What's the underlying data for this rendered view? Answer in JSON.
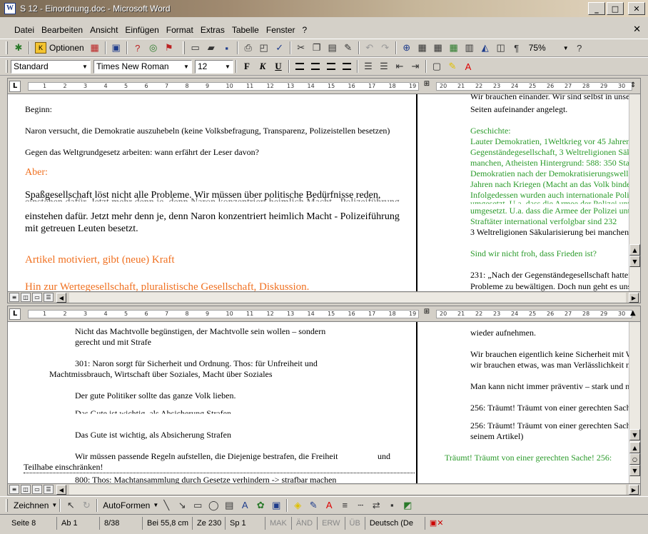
{
  "window": {
    "title": "S 12 - Einordnung.doc - Microsoft Word",
    "app_icon": "W"
  },
  "menu": [
    "Datei",
    "Bearbeiten",
    "Ansicht",
    "Einfügen",
    "Format",
    "Extras",
    "Tabelle",
    "Fenster",
    "?"
  ],
  "toolbar": {
    "options_label": "Optionen",
    "zoom": "75%"
  },
  "format_bar": {
    "style": "Standard",
    "font": "Times New Roman",
    "size": "12",
    "bold": "F",
    "italic": "K",
    "underline": "U"
  },
  "ruler_numbers": [
    "1",
    "2",
    "3",
    "4",
    "5",
    "6",
    "7",
    "8",
    "9",
    "10",
    "11",
    "12",
    "13",
    "14",
    "15",
    "16",
    "17",
    "18",
    "19"
  ],
  "ruler_numbers_right": [
    "20",
    "21",
    "22",
    "23",
    "24",
    "25",
    "26",
    "27",
    "28",
    "29",
    "30"
  ],
  "pane1": {
    "left": [
      "Beginn:",
      "Naron versucht, die Demokratie auszuhebeln (keine Volksbefragung, Transparenz, Polizeistellen besetzen)",
      "Gegen das Weltgrundgesetz arbeiten: wann erfährt der Leser davon?",
      "Aber:",
      "Spaßgesellschaft löst nicht alle Probleme. Wir müssen über politische Bedürfnisse reden,",
      "einstehen dafür. Jetzt mehr denn je, denn Naron konzentriert heimlich Macht - Polizeiführung",
      "einstehen dafür. Jetzt mehr denn je, denn Naron konzentriert heimlich Macht - Polizeiführung",
      "mit getreuen Leuten besetzt.",
      "Artikel motiviert, gibt (neue) Kraft",
      "Hin zur Wertegesellschaft, pluralistische Gesellschaft, Diskussion."
    ],
    "right": [
      "Wir brauchen einander. Wir sind selbst in unse",
      "Seiten aufeinander angelegt.",
      "Geschichte:",
      "Lauter Demokratien, 1Weltkrieg vor 45 Jahren",
      "Gegenständegesellschaft, 3 Weltreligionen Säkul",
      "manchen, Atheisten Hintergrund: 588: 350 Sta",
      "Demokratien nach der Demokratisierungswelle",
      "Jahren nach Kriegen (Macht an das Volk binde",
      "Infolgedessen wurden auch internationale Poliz",
      "umgesetzt. U.a. dass die Armee der Polizei unt",
      "umgesetzt. U.a. dass die Armee der Polizei unt",
      "Straftäter international verfolgbar sind 232",
      "3 Weltreligionen Säkularisierung bei manchen",
      "Sind wir nicht froh, dass Frieden ist?",
      "231: „Nach der Gegenständegesellschaft hatten w",
      "Probleme zu bewältigen. Doch nun geht es uns"
    ]
  },
  "pane2": {
    "left": [
      "Nicht das Machtvolle begünstigen, der Machtvolle sein wollen – sondern",
      "gerecht und mit Strafe",
      "301: Naron sorgt für Sicherheit und Ordnung. Thos: für Unfreiheit und",
      "Machtmissbrauch, Wirtschaft über Soziales, Macht über Soziales",
      "Der gute Politiker sollte das ganze Volk lieben.",
      "Das Gute ist wichtig, als Absicherung Strafen",
      "Das Gute ist wichtig, als Absicherung Strafen",
      "Wir müssen passende Regeln aufstellen, die Diejenige bestrafen, die Freiheit",
      "und",
      "Teilhabe einschränken!",
      "800: Thos: Machtansammlung durch Gesetze verhindern -> strafbar machen"
    ],
    "right": [
      "wieder aufnehmen.",
      "Wir brauchen eigentlich keine Sicherheit mit W",
      "wir brauchen etwas, was man Verlässlichkeit n",
      "Man kann nicht immer präventiv – stark und n",
      "256: Träumt! Träumt von einer gerechten Sach",
      "256: Träumt! Träumt von einer gerechten Sach",
      "seinem Artikel)",
      "Träumt! Träumt von einer gerechten Sache! 256:"
    ]
  },
  "drawing": {
    "draw_label": "Zeichnen",
    "autoshapes_label": "AutoFormen"
  },
  "status": {
    "page": "Seite 8",
    "section": "Ab 1",
    "pages": "8/38",
    "position": "Bei 55,8 cm",
    "line": "Ze 230",
    "col": "Sp 1",
    "mak": "MAK",
    "and": "ÄND",
    "erw": "ERW",
    "ub": "ÜB",
    "lang": "Deutsch (De"
  },
  "colors": {
    "orange": "#f07020",
    "green": "#2a9a2a"
  }
}
